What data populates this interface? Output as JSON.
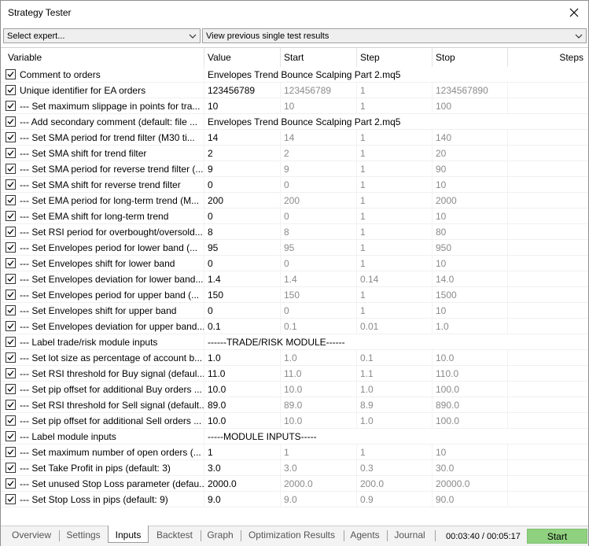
{
  "window": {
    "title": "Strategy Tester"
  },
  "toolbar": {
    "expert_select": "Select expert...",
    "results_select": "View previous single test results"
  },
  "columns": {
    "variable": "Variable",
    "value": "Value",
    "start": "Start",
    "step": "Step",
    "stop": "Stop",
    "steps": "Steps"
  },
  "rows": [
    {
      "variable": "Comment to orders",
      "value": "Envelopes Trend Bounce Scalping Part 2.mq5",
      "start": "",
      "step": "",
      "stop": ""
    },
    {
      "variable": "Unique identifier for EA orders",
      "value": "123456789",
      "start": "123456789",
      "step": "1",
      "stop": "1234567890"
    },
    {
      "variable": "--- Set maximum slippage in points for tra...",
      "value": "10",
      "start": "10",
      "step": "1",
      "stop": "100"
    },
    {
      "variable": "--- Add secondary comment (default: file ...",
      "value": "Envelopes Trend Bounce Scalping Part 2.mq5",
      "start": "",
      "step": "",
      "stop": ""
    },
    {
      "variable": "--- Set SMA period for trend filter (M30 ti...",
      "value": "14",
      "start": "14",
      "step": "1",
      "stop": "140"
    },
    {
      "variable": "--- Set SMA shift for trend filter",
      "value": "2",
      "start": "2",
      "step": "1",
      "stop": "20"
    },
    {
      "variable": "--- Set SMA period for reverse trend filter (...",
      "value": "9",
      "start": "9",
      "step": "1",
      "stop": "90"
    },
    {
      "variable": "--- Set SMA shift for reverse trend filter",
      "value": "0",
      "start": "0",
      "step": "1",
      "stop": "10"
    },
    {
      "variable": "--- Set EMA period for long-term trend (M...",
      "value": "200",
      "start": "200",
      "step": "1",
      "stop": "2000"
    },
    {
      "variable": "--- Set EMA shift for long-term trend",
      "value": "0",
      "start": "0",
      "step": "1",
      "stop": "10"
    },
    {
      "variable": "--- Set RSI period for overbought/oversold...",
      "value": "8",
      "start": "8",
      "step": "1",
      "stop": "80"
    },
    {
      "variable": "--- Set Envelopes period for lower band (...",
      "value": "95",
      "start": "95",
      "step": "1",
      "stop": "950"
    },
    {
      "variable": "--- Set Envelopes shift for lower band",
      "value": "0",
      "start": "0",
      "step": "1",
      "stop": "10"
    },
    {
      "variable": "--- Set Envelopes deviation for lower band...",
      "value": "1.4",
      "start": "1.4",
      "step": "0.14",
      "stop": "14.0"
    },
    {
      "variable": "--- Set Envelopes period for upper band (...",
      "value": "150",
      "start": "150",
      "step": "1",
      "stop": "1500"
    },
    {
      "variable": "--- Set Envelopes shift for upper band",
      "value": "0",
      "start": "0",
      "step": "1",
      "stop": "10"
    },
    {
      "variable": "--- Set Envelopes deviation for upper band...",
      "value": "0.1",
      "start": "0.1",
      "step": "0.01",
      "stop": "1.0"
    },
    {
      "variable": "--- Label trade/risk module inputs",
      "value": "------TRADE/RISK MODULE------",
      "start": "",
      "step": "",
      "stop": ""
    },
    {
      "variable": "--- Set lot size as percentage of account b...",
      "value": "1.0",
      "start": "1.0",
      "step": "0.1",
      "stop": "10.0"
    },
    {
      "variable": "--- Set RSI threshold for Buy signal (defaul...",
      "value": "11.0",
      "start": "11.0",
      "step": "1.1",
      "stop": "110.0"
    },
    {
      "variable": "--- Set pip offset for additional Buy orders ...",
      "value": "10.0",
      "start": "10.0",
      "step": "1.0",
      "stop": "100.0"
    },
    {
      "variable": "--- Set RSI threshold for Sell signal (default...",
      "value": "89.0",
      "start": "89.0",
      "step": "8.9",
      "stop": "890.0"
    },
    {
      "variable": "--- Set pip offset for additional Sell orders ...",
      "value": "10.0",
      "start": "10.0",
      "step": "1.0",
      "stop": "100.0"
    },
    {
      "variable": "--- Label module inputs",
      "value": "-----MODULE INPUTS-----",
      "start": "",
      "step": "",
      "stop": ""
    },
    {
      "variable": "--- Set maximum number of open orders (...",
      "value": "1",
      "start": "1",
      "step": "1",
      "stop": "10"
    },
    {
      "variable": "--- Set Take Profit in pips (default: 3)",
      "value": "3.0",
      "start": "3.0",
      "step": "0.3",
      "stop": "30.0"
    },
    {
      "variable": "--- Set unused Stop Loss parameter (defau...",
      "value": "2000.0",
      "start": "2000.0",
      "step": "200.0",
      "stop": "20000.0"
    },
    {
      "variable": "--- Set Stop Loss in pips (default: 9)",
      "value": "9.0",
      "start": "9.0",
      "step": "0.9",
      "stop": "90.0"
    }
  ],
  "tabs": [
    {
      "label": "Overview"
    },
    {
      "label": "Settings"
    },
    {
      "label": "Inputs"
    },
    {
      "label": "Backtest"
    },
    {
      "label": "Graph"
    },
    {
      "label": "Optimization Results"
    },
    {
      "label": "Agents"
    },
    {
      "label": "Journal"
    }
  ],
  "status": {
    "timer": "00:03:40 / 00:05:17",
    "start_label": "Start"
  },
  "colors": {
    "start_button": "#8fd17f",
    "dim_text": "#8a8a8a"
  },
  "icons": {
    "close": "close-icon",
    "dropdown": "chevron-down-icon",
    "checkbox": "checkbox-checked-icon"
  }
}
